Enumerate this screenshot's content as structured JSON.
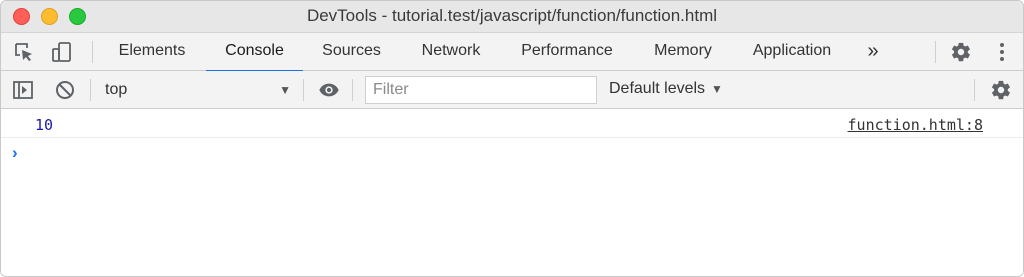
{
  "window": {
    "title": "DevTools - tutorial.test/javascript/function/function.html"
  },
  "toolbar": {
    "tabs": [
      {
        "label": "Elements"
      },
      {
        "label": "Console",
        "active": true
      },
      {
        "label": "Sources"
      },
      {
        "label": "Network"
      },
      {
        "label": "Performance"
      },
      {
        "label": "Memory"
      },
      {
        "label": "Application"
      }
    ],
    "more_label": "»"
  },
  "console_toolbar": {
    "context": "top",
    "filter_placeholder": "Filter",
    "levels_label": "Default levels"
  },
  "console": {
    "messages": [
      {
        "value": "10",
        "source": "function.html:8"
      }
    ],
    "prompt": "›"
  },
  "colors": {
    "accent": "#1a73e8",
    "number_value": "#1a1aa6"
  },
  "icons": [
    "inspect-icon",
    "device-icon",
    "more-tabs-icon",
    "settings-icon",
    "kebab-menu-icon",
    "sidebar-toggle-icon",
    "clear-icon",
    "eye-icon",
    "console-settings-icon"
  ]
}
